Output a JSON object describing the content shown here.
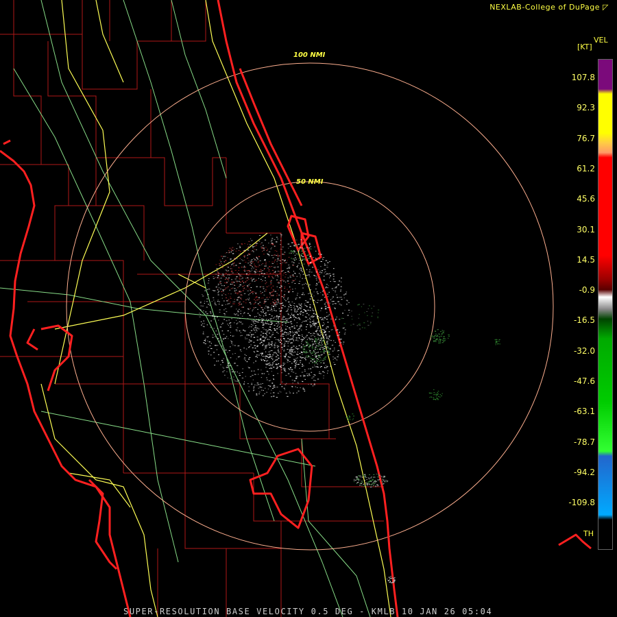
{
  "header": {
    "credit": "NEXLAB-College of DuPage",
    "credit_icon": "logo-mark-icon"
  },
  "footer": {
    "caption": "SUPER-RESOLUTION BASE VELOCITY 0.5 DEG - KMLB 10 JAN 26 05:04"
  },
  "rings": {
    "inner_label": "50 NMI",
    "outer_label": "100 NMI"
  },
  "legend": {
    "product": "VEL",
    "unit": "[KT]",
    "ticks": [
      "107.8",
      "92.3",
      "76.7",
      "61.2",
      "45.6",
      "30.1",
      "14.5",
      "-0.9",
      "-16.5",
      "-32.0",
      "-47.6",
      "-63.1",
      "-78.7",
      "-94.2",
      "-109.8"
    ],
    "th_label": "TH",
    "colors": {
      "purple": "#7b0a7b",
      "yellow": "#ffff00",
      "orange": "#ff9966",
      "red": "#ff0000",
      "darkred": "#5a0000",
      "gray": "#888888",
      "green": "#00cc00",
      "darkgreen": "#004400",
      "blue": "#2266cc",
      "cyan": "#00aaff",
      "black": "#000000"
    }
  },
  "map": {
    "coast_color": "#ff2020",
    "county_color": "#b01818",
    "highway_yellow": "#ffff55",
    "highway_green": "#88dd88",
    "ring_color": "#ffb090"
  }
}
